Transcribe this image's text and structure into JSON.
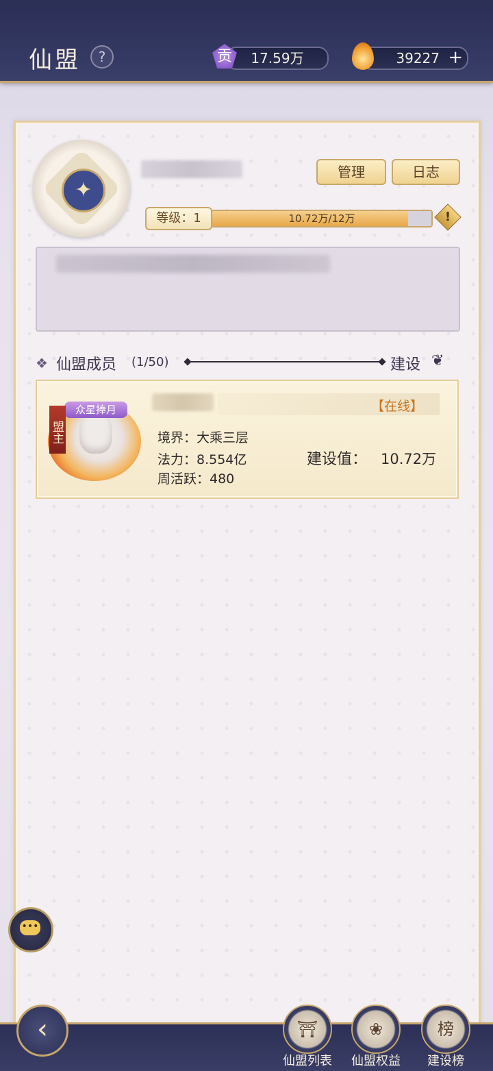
{
  "header": {
    "title": "仙盟",
    "help_icon": "?",
    "contribution_icon": "贡",
    "contribution": "17.59万",
    "spirit_amount": "39227",
    "add_label": "+"
  },
  "guild": {
    "emblem_icon": "phoenix-emblem-icon",
    "manage_label": "管理",
    "log_label": "日志",
    "level_label": "等级：1",
    "progress_text": "10.72万/12万",
    "progress_fraction": 0.893,
    "warn_icon": "!"
  },
  "members": {
    "title": "仙盟成员",
    "count": "(1/50)",
    "sort_label": "建设",
    "list": [
      {
        "badge": "众星捧月",
        "role": "盟主",
        "status": "【在线】",
        "realm": "境界：大乘三层",
        "power": "法力：8.554亿",
        "weekly_active": "周活跃：480",
        "build_label": "建设值：",
        "build_value": "10.72万"
      }
    ]
  },
  "chat_icon": "•••",
  "nav": {
    "back_icon": "back-arrow-icon",
    "items": [
      {
        "label": "仙盟列表",
        "icon": "⛩"
      },
      {
        "label": "仙盟权益",
        "icon": "❀"
      },
      {
        "label": "建设榜",
        "icon": "榜"
      }
    ]
  },
  "colors": {
    "accent_gold": "#c6a66b",
    "topbar": "#2b2f56",
    "progress_fill": "#e8a84a",
    "online_text": "#c9741f"
  }
}
